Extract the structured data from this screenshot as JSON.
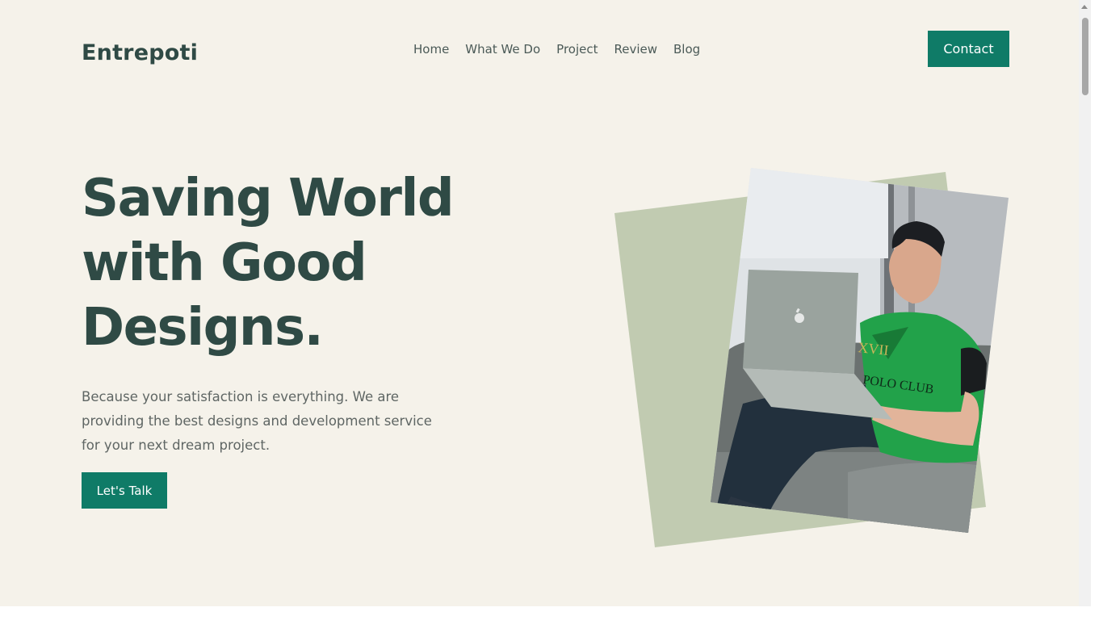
{
  "brand": {
    "name": "Entrepoti"
  },
  "nav": {
    "items": [
      {
        "label": "Home"
      },
      {
        "label": "What We Do"
      },
      {
        "label": "Project"
      },
      {
        "label": "Review"
      },
      {
        "label": "Blog"
      }
    ],
    "contact_label": "Contact"
  },
  "hero": {
    "headline_line1": "Saving World",
    "headline_line2": "with Good",
    "headline_line3": "Designs.",
    "description": "Because your satisfaction is everything. We are providing the best designs and development service for your next dream project.",
    "cta_label": "Let's Talk",
    "shirt_text_1": "XVII",
    "shirt_text_2": "POLO CLUB"
  },
  "colors": {
    "background": "#f5f2ea",
    "accent": "#0f7b67",
    "heading": "#2f4a45",
    "body_text": "#5f6664",
    "backdrop_shape": "#c1cbb1"
  }
}
